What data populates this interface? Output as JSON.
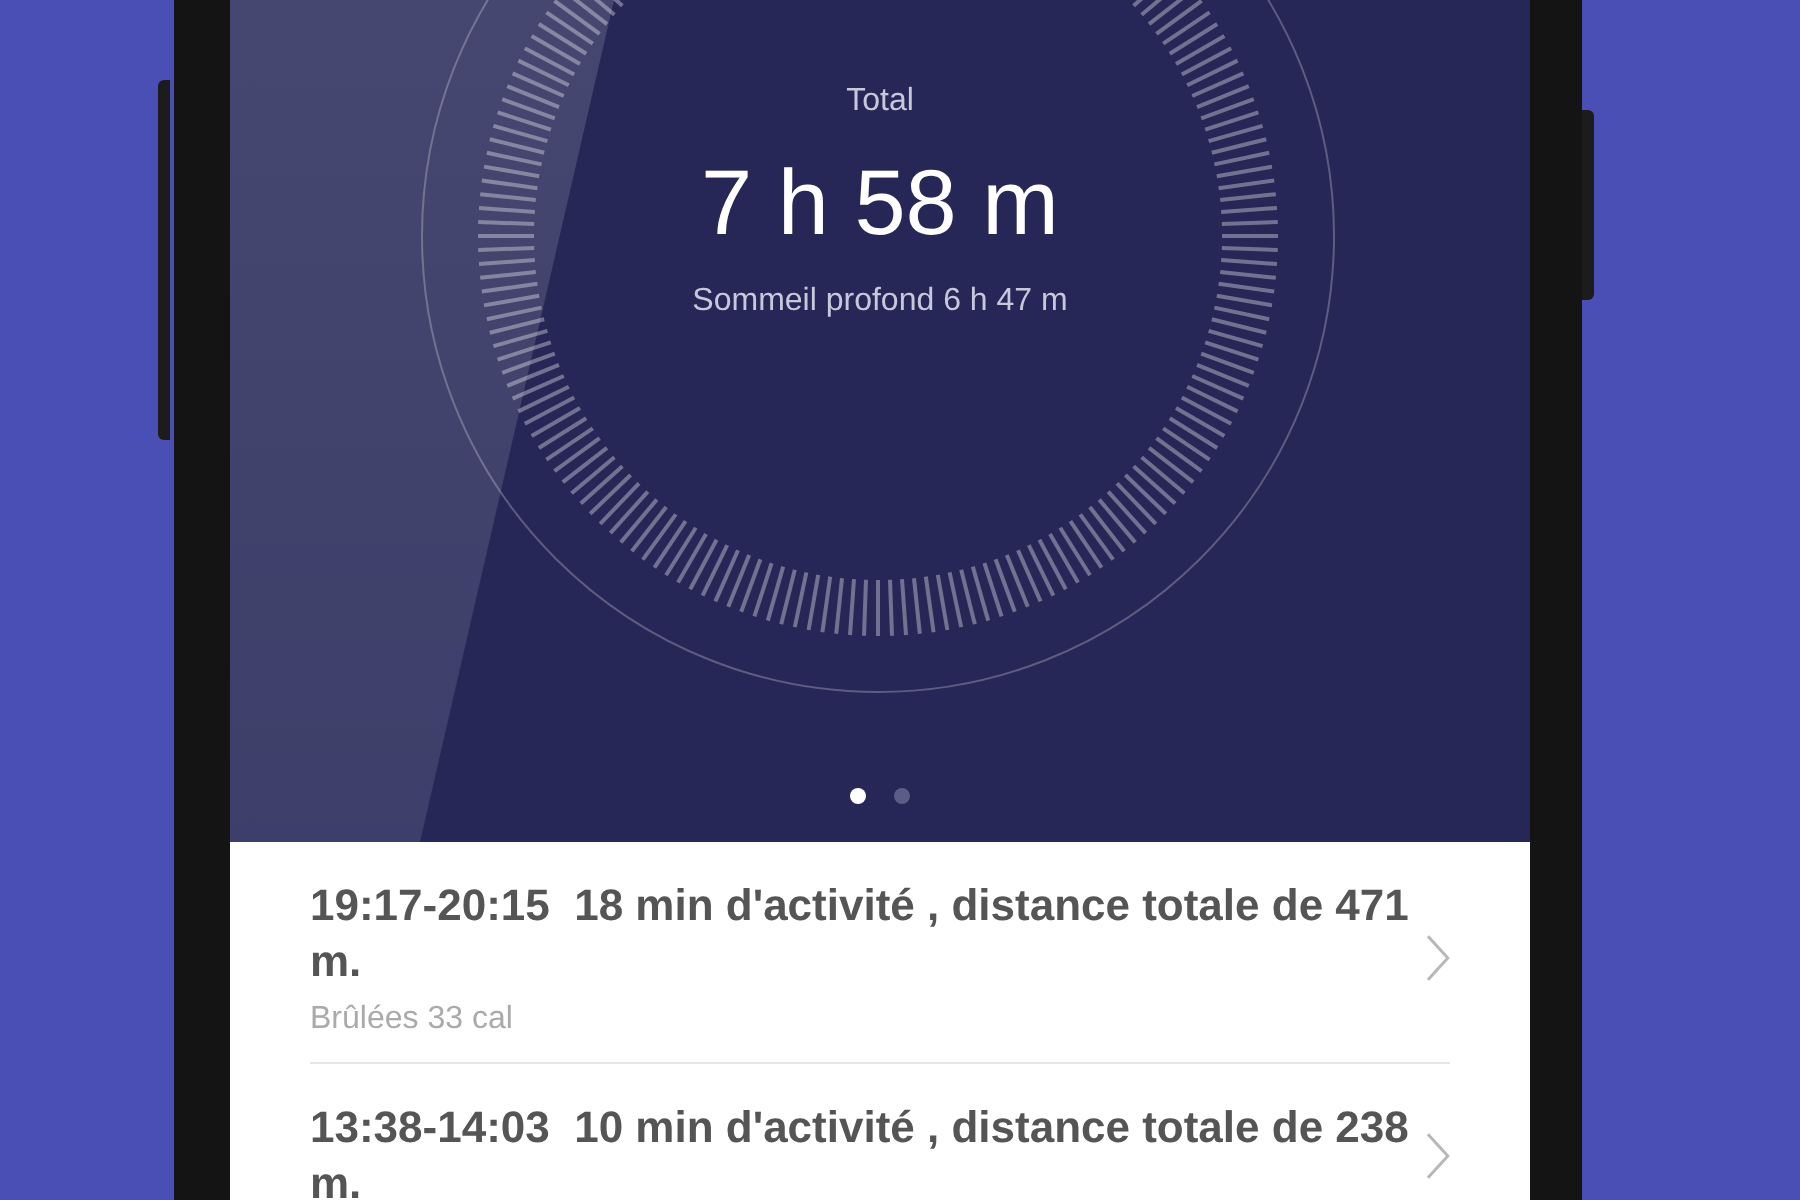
{
  "summary": {
    "label": "Total",
    "value": "7 h 58 m",
    "detail": "Sommeil profond 6 h 47 m"
  },
  "pages": [
    {
      "selected": true
    },
    {
      "selected": false
    }
  ],
  "activities": [
    {
      "title": "19:17-20:15  18 min d'activité , distance totale de 471 m.",
      "subtitle": "Brûlées 33 cal"
    },
    {
      "title": "13:38-14:03  10 min d'activité , distance totale de 238 m."
    }
  ]
}
